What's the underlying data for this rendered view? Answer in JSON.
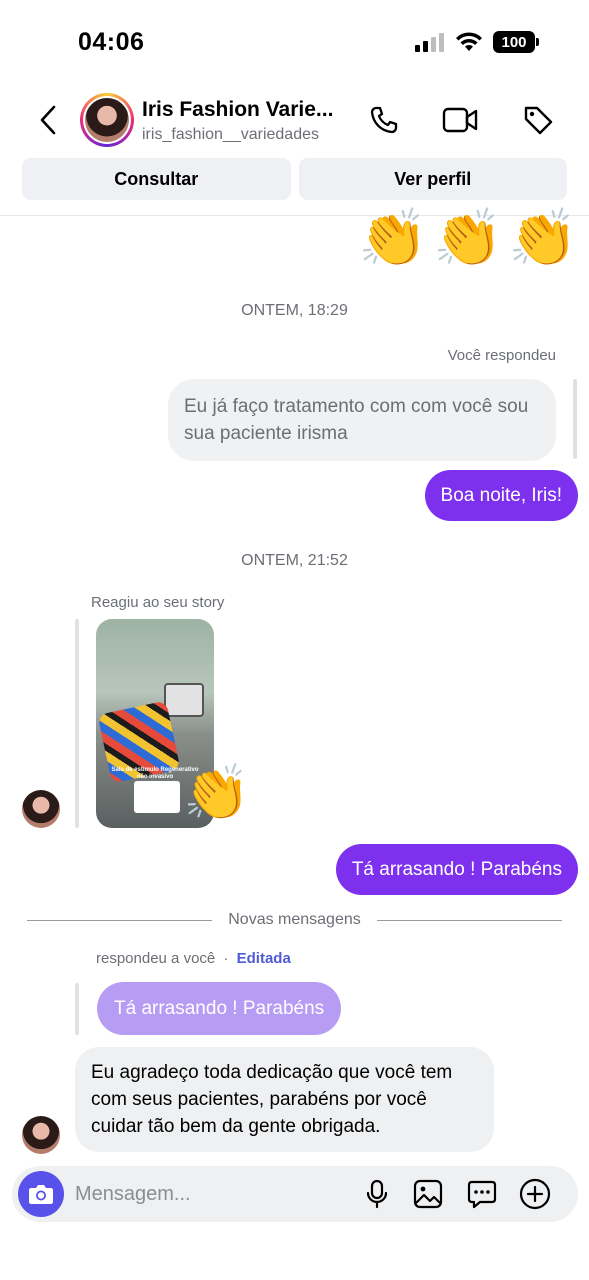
{
  "status_bar": {
    "time": "04:06",
    "battery": "100"
  },
  "header": {
    "name": "Iris Fashion Varie...",
    "username": "iris_fashion__variedades",
    "consult_label": "Consultar",
    "profile_label": "Ver perfil"
  },
  "chat": {
    "reaction_emoji": "👏",
    "timestamp_1": "ONTEM, 18:29",
    "you_replied": "Você respondeu",
    "quoted_message": "Eu já faço tratamento com com você sou sua paciente irisma",
    "msg_good_night": "Boa noite, Iris!",
    "timestamp_2": "ONTEM, 21:52",
    "reacted_story": "Reagiu ao seu story",
    "story_caption": "Sala de estimulo Regenerativo não invasivo",
    "story_reaction": "👏",
    "msg_congrats": "Tá arrasando ! Parabéns",
    "new_messages": "Novas mensagens",
    "replied_to_you": "respondeu a você",
    "separator": "·",
    "edited": "Editada",
    "quoted_reply": "Tá arrasando ! Parabéns",
    "incoming_message": "Eu agradeço toda dedicação que você tem com seus pacientes, parabéns por você cuidar tão bem da gente obrigada."
  },
  "composer": {
    "placeholder": "Mensagem..."
  },
  "colors": {
    "accent_purple": "#7d31ee",
    "light_purple": "#b79cf4",
    "camera_blue": "#5851ea",
    "edited_link": "#4f5bd5"
  }
}
